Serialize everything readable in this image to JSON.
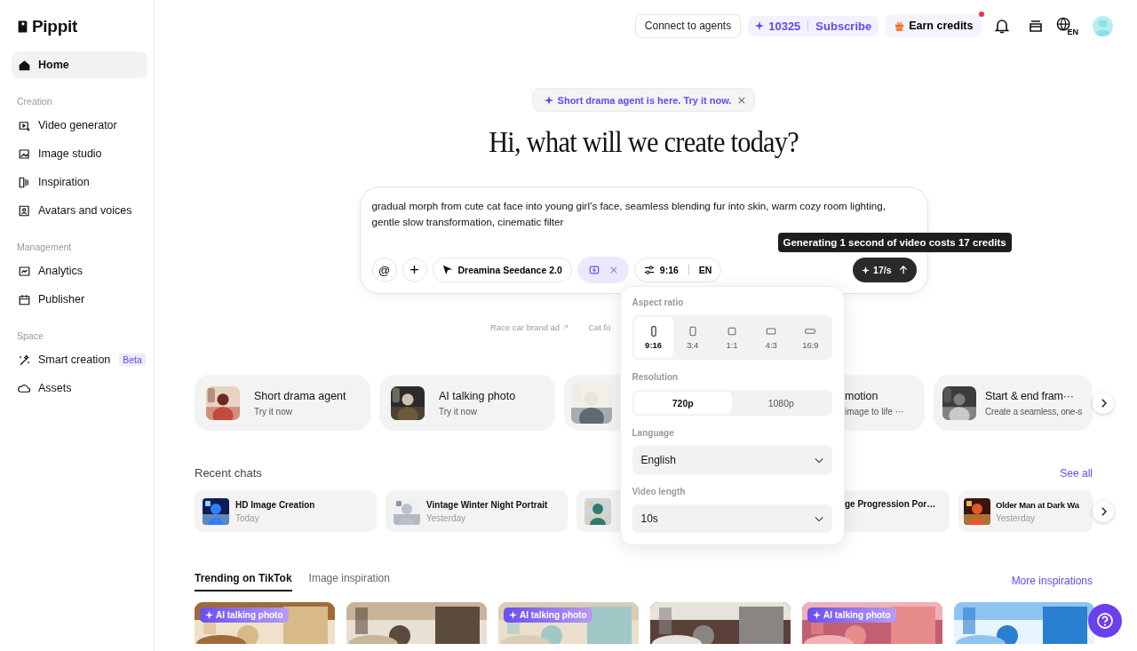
{
  "sidebar": {
    "brand": "Pippit",
    "top": [
      {
        "label": "Home",
        "selected": true
      }
    ],
    "sections": [
      {
        "title": "Creation",
        "items": [
          {
            "label": "Video generator",
            "selected": false
          },
          {
            "label": "Image studio",
            "selected": false
          },
          {
            "label": "Inspiration",
            "selected": false
          },
          {
            "label": "Avatars and voices",
            "selected": false
          }
        ]
      },
      {
        "title": "Management",
        "items": [
          {
            "label": "Analytics",
            "selected": false
          },
          {
            "label": "Publisher",
            "selected": false
          }
        ]
      },
      {
        "title": "Space",
        "items": [
          {
            "label": "Smart creation",
            "selected": false,
            "badge": "Beta"
          },
          {
            "label": "Assets",
            "selected": false
          }
        ]
      }
    ]
  },
  "topbar": {
    "connect": "Connect to agents",
    "credits": "10325",
    "subscribe": "Subscribe",
    "earn": {
      "label": "Earn credits",
      "has_new": true
    },
    "language": "EN"
  },
  "announcement": "Short drama agent is here. Try it now.",
  "heading": "Hi, what will we create today?",
  "prompt": {
    "text": "gradual morph from cute cat face into young girl’s face, seamless blending fur into skin, warm cozy room lighting, gentle slow transformation, cinematic filter",
    "at": "@",
    "plus": "+",
    "model": "Dreamina Seedance 2.0",
    "mode_selected": true,
    "ratio": "9:16",
    "lang": "EN",
    "cost": "17/s",
    "tooltip": "Generating 1 second of video costs 17 credits"
  },
  "suggestions": [
    {
      "label": "Race car brand ad",
      "kind": "link"
    },
    {
      "label": "Cat fo",
      "kind": "plain"
    }
  ],
  "settings": {
    "aspect_title": "Aspect ratio",
    "aspect_ratios": [
      {
        "label": "9:16",
        "selected": true
      },
      {
        "label": "3:4",
        "selected": false
      },
      {
        "label": "1:1",
        "selected": false
      },
      {
        "label": "4:3",
        "selected": false
      },
      {
        "label": "16:9",
        "selected": false
      }
    ],
    "resolution_title": "Resolution",
    "resolutions": [
      {
        "label": "720p",
        "selected": true
      },
      {
        "label": "1080p",
        "selected": false
      }
    ],
    "language_title": "Language",
    "language": "English",
    "length_title": "Video length",
    "length": "10s"
  },
  "features": [
    {
      "kind": "full",
      "title": "Short drama agent",
      "subtitle": "Try it now"
    },
    {
      "kind": "full",
      "title": "AI talking photo",
      "subtitle": "Try it now"
    },
    {
      "kind": "thumb"
    },
    {
      "kind": "tail",
      "title": "motion",
      "subtitle": "image to life ···"
    },
    {
      "kind": "full",
      "title": "Start & end fram···",
      "subtitle": "Create a seamless, one-s"
    }
  ],
  "recent": {
    "title": "Recent chats",
    "see_all": "See all",
    "chats": [
      {
        "kind": "full",
        "title": "HD Image Creation",
        "subtitle": "Today"
      },
      {
        "kind": "full",
        "title": "Vintage Winter Night Portrait",
        "subtitle": "Yesterday"
      },
      {
        "kind": "thumb"
      },
      {
        "kind": "tail",
        "title": "ge Progression Por…"
      },
      {
        "kind": "full",
        "title": "Older Man at Dark Wa",
        "subtitle": "Yesterday"
      }
    ]
  },
  "tabs": [
    {
      "label": "Trending on TikTok",
      "selected": true
    },
    {
      "label": "Image inspiration",
      "selected": false
    }
  ],
  "more": "More inspirations",
  "thumbs": [
    {
      "kind": "picture",
      "badge": "AI talking photo"
    },
    {
      "kind": "picture"
    },
    {
      "kind": "picture",
      "badge": "AI talking photo"
    },
    {
      "kind": "picture"
    },
    {
      "kind": "picture",
      "badge": "AI talking photo"
    },
    {
      "kind": "picture"
    }
  ]
}
